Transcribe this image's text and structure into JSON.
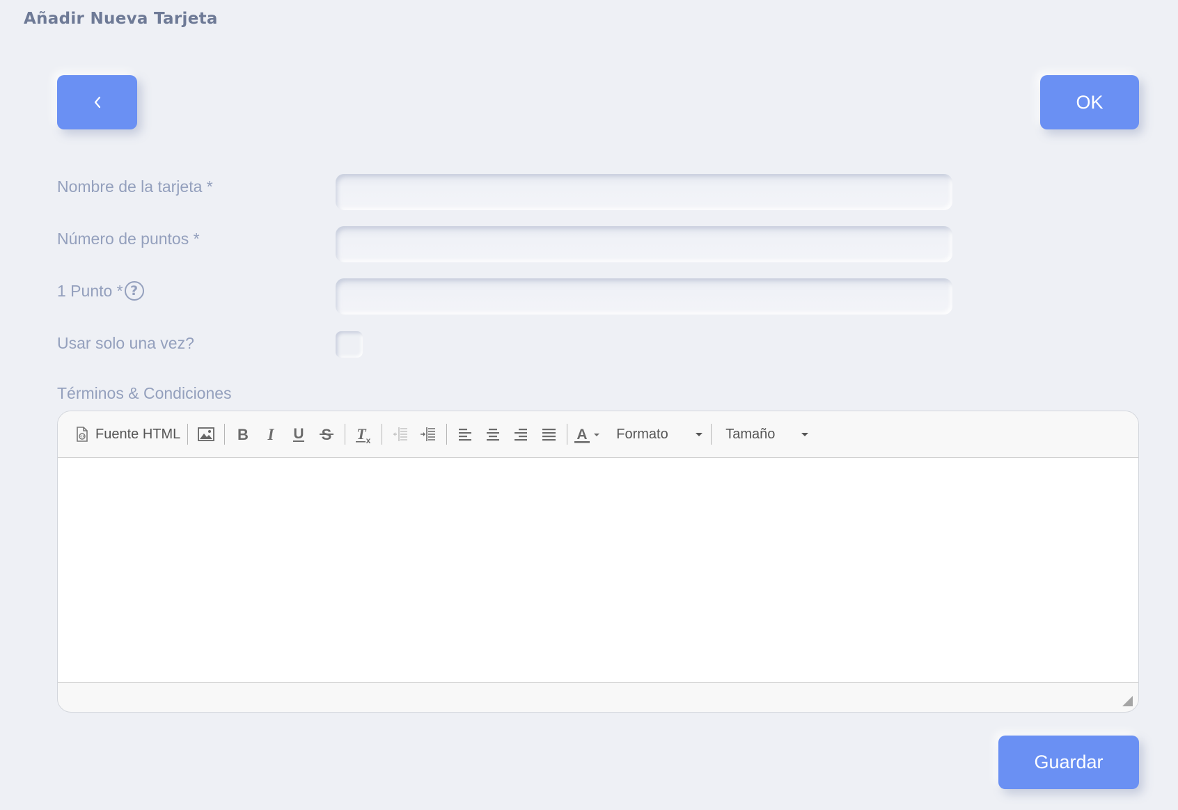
{
  "page": {
    "title": "Añadir Nueva Tarjeta"
  },
  "buttons": {
    "back_icon": "chevron-left-icon",
    "ok_label": "OK",
    "save_label": "Guardar"
  },
  "form": {
    "card_name_label": "Nombre de la tarjeta *",
    "card_name_value": "",
    "points_number_label": "Número de puntos *",
    "points_number_value": "",
    "one_point_label": "1 Punto *",
    "one_point_value": "",
    "one_point_help_icon": "question-circle-icon",
    "use_once_label": "Usar solo una vez?",
    "use_once_checked": false,
    "terms_label": "Términos & Condiciones"
  },
  "editor": {
    "toolbar": {
      "source_label": "Fuente HTML",
      "format_label": "Formato",
      "size_label": "Tamaño",
      "icons": [
        "source-icon",
        "image-icon",
        "bold-icon",
        "italic-icon",
        "underline-icon",
        "strikethrough-icon",
        "remove-format-icon",
        "outdent-icon",
        "indent-icon",
        "align-left-icon",
        "align-center-icon",
        "align-right-icon",
        "justify-icon",
        "text-color-icon"
      ]
    },
    "content": ""
  },
  "colors": {
    "accent": "#6a90f3",
    "background": "#eef0f5",
    "label": "#94a0bd",
    "title": "#6e7a96"
  }
}
